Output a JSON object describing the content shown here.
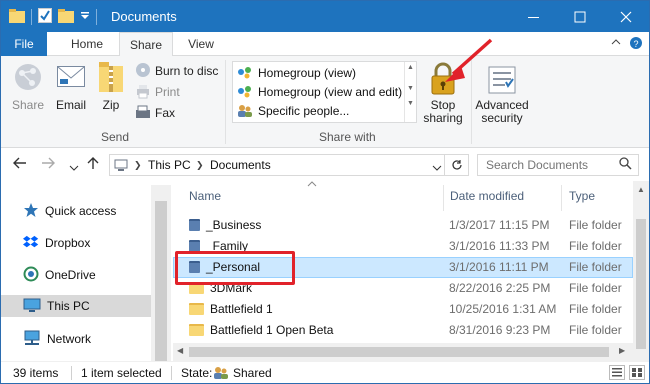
{
  "window": {
    "title": "Documents",
    "controls": {
      "minimize": "—",
      "maximize": "☐",
      "close": "✕"
    }
  },
  "ribbon_tabs": {
    "file": "File",
    "home": "Home",
    "share": "Share",
    "view": "View",
    "active": "Share"
  },
  "ribbon": {
    "share_group": {
      "share": "Share",
      "email": "Email",
      "zip": "Zip",
      "burn": "Burn to disc",
      "print": "Print",
      "fax": "Fax",
      "label": "Send"
    },
    "share_with_group": {
      "items": [
        "Homegroup (view)",
        "Homegroup (view and edit)",
        "Specific people..."
      ],
      "stop_sharing": [
        "Stop",
        "sharing"
      ],
      "label": "Share with"
    },
    "advanced_security": [
      "Advanced",
      "security"
    ]
  },
  "address_bar": {
    "crumbs": [
      "This PC",
      "Documents"
    ],
    "search_placeholder": "Search Documents"
  },
  "nav_pane": {
    "items": [
      {
        "label": "Quick access",
        "icon": "star-icon"
      },
      {
        "label": "Dropbox",
        "icon": "dropbox-icon"
      },
      {
        "label": "OneDrive",
        "icon": "onedrive-icon"
      },
      {
        "label": "This PC",
        "icon": "computer-icon",
        "selected": true
      },
      {
        "label": "Network",
        "icon": "network-icon"
      }
    ]
  },
  "file_list": {
    "columns": {
      "name": "Name",
      "date": "Date modified",
      "type": "Type"
    },
    "rows": [
      {
        "name": "_Business",
        "date": "1/3/2017 11:15 PM",
        "type": "File folder",
        "shared": true
      },
      {
        "name": "_Family",
        "date": "3/1/2016 11:33 PM",
        "type": "File folder",
        "shared": true
      },
      {
        "name": "_Personal",
        "date": "3/1/2016 11:11 PM",
        "type": "File folder",
        "shared": true,
        "selected": true
      },
      {
        "name": "3DMark",
        "date": "8/22/2016 2:25 PM",
        "type": "File folder",
        "shared": false
      },
      {
        "name": "Battlefield 1",
        "date": "10/25/2016 1:31 AM",
        "type": "File folder",
        "shared": false
      },
      {
        "name": "Battlefield 1 Open Beta",
        "date": "8/31/2016 9:23 PM",
        "type": "File folder",
        "shared": false
      }
    ]
  },
  "status_bar": {
    "items_count": "39 items",
    "selected": "1 item selected",
    "state_label": "State:",
    "state_value": "Shared"
  },
  "colors": {
    "title_bar": "#1e73be",
    "selection": "#cce8ff",
    "annotation": "#e1222a"
  }
}
